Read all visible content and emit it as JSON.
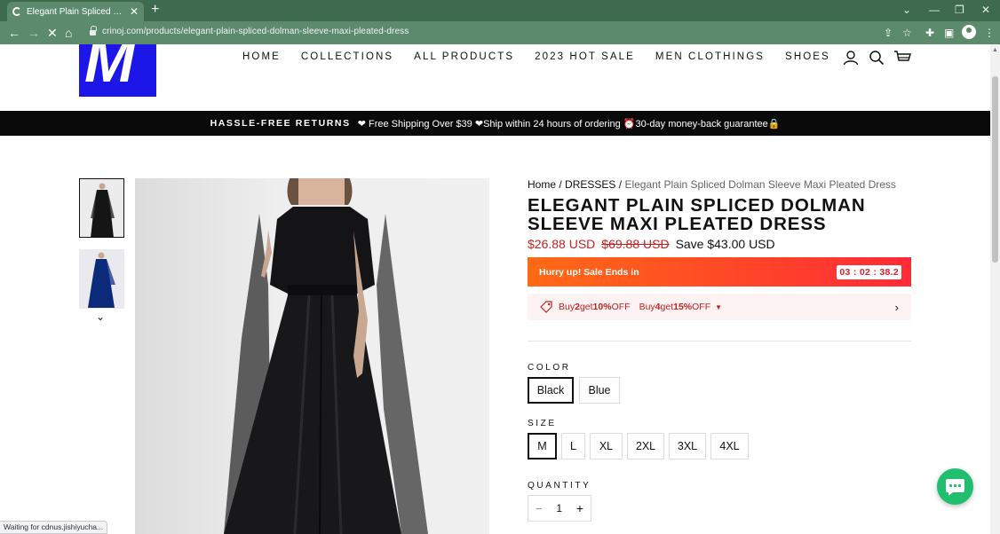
{
  "browser": {
    "tab_title": "Elegant Plain Spliced Dolman Sleeve Maxi Pleated Dress",
    "new_tab_symbol": "+",
    "url": "crinoj.com/products/elegant-plain-spliced-dolman-sleeve-maxi-pleated-dress",
    "status_text": "Waiting for cdnus.jishiyucha...",
    "accent_color": "#5c8a6c"
  },
  "site": {
    "logo_letter": "M",
    "logo_color": "#1c17e8",
    "nav": [
      "HOME",
      "COLLECTIONS",
      "ALL PRODUCTS",
      "2023 HOT SALE",
      "MEN CLOTHINGS",
      "SHOES"
    ],
    "announcement": {
      "strong": "HASSLE-FREE RETURNS",
      "text": "❤ Free Shipping Over $39 ❤Ship within 24 hours of ordering ⏰30-day money-back guarantee🔒"
    }
  },
  "breadcrumb": {
    "home": "Home",
    "sep": "/",
    "category": "DRESSES",
    "current": "Elegant Plain Spliced Dolman Sleeve Maxi Pleated Dress"
  },
  "product": {
    "title": "ELEGANT PLAIN SPLICED DOLMAN SLEEVE MAXI PLEATED DRESS",
    "price": "$26.88 USD",
    "compare_price": "$69.88 USD",
    "save": "Save $43.00 USD",
    "sale_color": "#c42121"
  },
  "countdown": {
    "label": "Hurry up! Sale Ends in",
    "timer": "03 : 02 : 38.2"
  },
  "offer": {
    "buy1": "Buy ",
    "qty1": "2",
    "get1": " get ",
    "pct1": "10%",
    "off1": " OFF",
    "buy2": "Buy ",
    "qty2": "4",
    "get2": " get ",
    "pct2": "15%",
    "off2": " OFF"
  },
  "options": {
    "color_label": "COLOR",
    "colors": [
      "Black",
      "Blue"
    ],
    "selected_color": "Black",
    "size_label": "SIZE",
    "sizes": [
      "M",
      "L",
      "XL",
      "2XL",
      "3XL",
      "4XL"
    ],
    "selected_size": "M",
    "quantity_label": "QUANTITY",
    "quantity": "1",
    "minus": "−",
    "plus": "+"
  }
}
